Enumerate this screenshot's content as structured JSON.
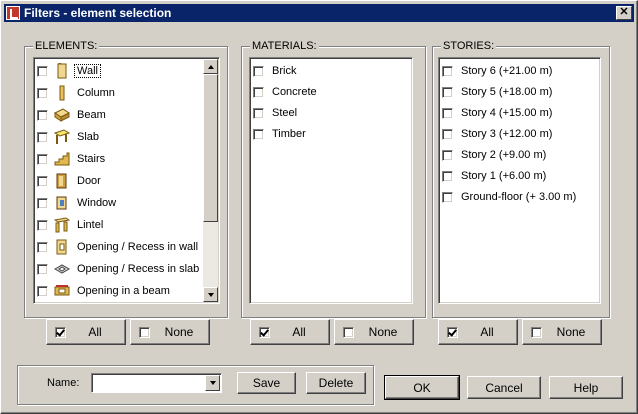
{
  "window": {
    "title": "Filters - element selection",
    "close_glyph": "✕"
  },
  "elements": {
    "label": "ELEMENTS:",
    "items": [
      {
        "label": "Wall",
        "icon": "wall-icon",
        "checked": false,
        "focused": true
      },
      {
        "label": "Column",
        "icon": "column-icon",
        "checked": false
      },
      {
        "label": "Beam",
        "icon": "beam-icon",
        "checked": false
      },
      {
        "label": "Slab",
        "icon": "slab-icon",
        "checked": false
      },
      {
        "label": "Stairs",
        "icon": "stairs-icon",
        "checked": false
      },
      {
        "label": "Door",
        "icon": "door-icon",
        "checked": false
      },
      {
        "label": "Window",
        "icon": "window-icon",
        "checked": false
      },
      {
        "label": "Lintel",
        "icon": "lintel-icon",
        "checked": false
      },
      {
        "label": "Opening / Recess in wall",
        "icon": "wall-opening-icon",
        "checked": false
      },
      {
        "label": "Opening / Recess in slab",
        "icon": "slab-opening-icon",
        "checked": false
      },
      {
        "label": "Opening in a beam",
        "icon": "beam-opening-icon",
        "checked": false
      }
    ],
    "all_label": "All",
    "none_label": "None",
    "all_checked": true,
    "none_checked": false
  },
  "materials": {
    "label": "MATERIALS:",
    "items": [
      {
        "label": "Brick",
        "checked": false
      },
      {
        "label": "Concrete",
        "checked": false
      },
      {
        "label": "Steel",
        "checked": false
      },
      {
        "label": "Timber",
        "checked": false
      }
    ],
    "all_label": "All",
    "none_label": "None",
    "all_checked": true,
    "none_checked": false
  },
  "stories": {
    "label": "STORIES:",
    "items": [
      {
        "label": "Story 6 (+21.00 m)",
        "checked": false
      },
      {
        "label": "Story 5 (+18.00 m)",
        "checked": false
      },
      {
        "label": "Story 4 (+15.00 m)",
        "checked": false
      },
      {
        "label": "Story 3 (+12.00 m)",
        "checked": false
      },
      {
        "label": "Story 2 (+9.00 m)",
        "checked": false
      },
      {
        "label": "Story 1 (+6.00 m)",
        "checked": false
      },
      {
        "label": "Ground-floor (+ 3.00 m)",
        "checked": false
      }
    ],
    "all_label": "All",
    "none_label": "None",
    "all_checked": true,
    "none_checked": false
  },
  "name_row": {
    "label": "Name:",
    "value": "",
    "save_label": "Save",
    "delete_label": "Delete"
  },
  "footer": {
    "ok_label": "OK",
    "cancel_label": "Cancel",
    "help_label": "Help"
  },
  "colors": {
    "titlebar": "#0a246a",
    "face": "#d4d0c8"
  }
}
